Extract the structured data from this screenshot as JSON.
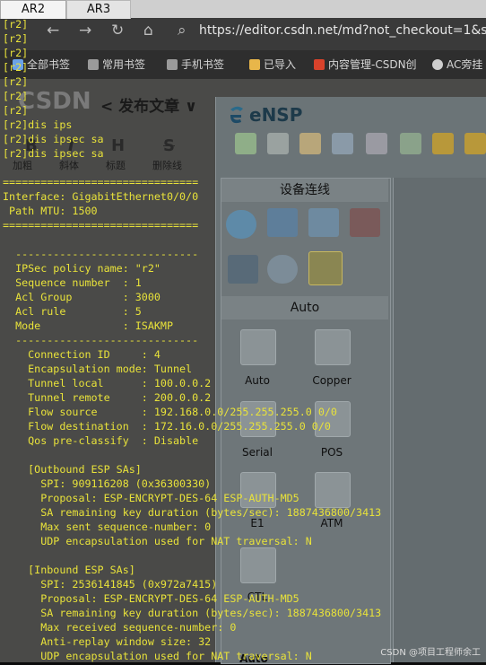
{
  "tabs": [
    {
      "label": "AR2"
    },
    {
      "label": "AR3"
    }
  ],
  "browser": {
    "url": "https://editor.csdn.net/md?not_checkout=1&sp",
    "bookmarks": [
      "全部书签",
      "常用书签",
      "手机书签",
      "已导入",
      "内容管理-CSDN创",
      "AC旁挂"
    ]
  },
  "editor": {
    "logo": "CSDN",
    "title": "< 发布文章 ∨",
    "toolbar": [
      {
        "icon": "B",
        "label": "加粗"
      },
      {
        "icon": "I",
        "label": "斜体"
      },
      {
        "icon": "H",
        "label": "标题"
      },
      {
        "icon": "S",
        "label": "删除线"
      }
    ]
  },
  "ensp": {
    "title": "eNSP",
    "panel_title": "设备连线",
    "auto_header": "Auto",
    "cables": [
      "Auto",
      "Copper",
      "Serial",
      "POS",
      "E1",
      "ATM",
      "CTL"
    ],
    "next_header": "Auto"
  },
  "terminal": {
    "lines": [
      "[r2]",
      "[r2]",
      "[r2]",
      "[r2]",
      "[r2]",
      "[r2]",
      "[r2]",
      "[r2]dis ips",
      "[r2]dis ipsec sa",
      "[r2]dis ipsec sa",
      "",
      "===============================",
      "Interface: GigabitEthernet0/0/0",
      " Path MTU: 1500",
      "===============================",
      "",
      "  -----------------------------",
      "  IPSec policy name: \"r2\"",
      "  Sequence number  : 1",
      "  Acl Group        : 3000",
      "  Acl rule         : 5",
      "  Mode             : ISAKMP",
      "  -----------------------------",
      "    Connection ID     : 4",
      "    Encapsulation mode: Tunnel",
      "    Tunnel local      : 100.0.0.2",
      "    Tunnel remote     : 200.0.0.2",
      "    Flow source       : 192.168.0.0/255.255.255.0 0/0",
      "    Flow destination  : 172.16.0.0/255.255.255.0 0/0",
      "    Qos pre-classify  : Disable",
      "",
      "    [Outbound ESP SAs]",
      "      SPI: 909116208 (0x36300330)",
      "      Proposal: ESP-ENCRYPT-DES-64 ESP-AUTH-MD5",
      "      SA remaining key duration (bytes/sec): 1887436800/3413",
      "      Max sent sequence-number: 0",
      "      UDP encapsulation used for NAT traversal: N",
      "",
      "    [Inbound ESP SAs]",
      "      SPI: 2536141845 (0x972a7415)",
      "      Proposal: ESP-ENCRYPT-DES-64 ESP-AUTH-MD5",
      "      SA remaining key duration (bytes/sec): 1887436800/3413",
      "      Max received sequence-number: 0",
      "      Anti-replay window size: 32",
      "      UDP encapsulation used for NAT traversal: N"
    ]
  },
  "watermark": "CSDN @项目工程师余工"
}
